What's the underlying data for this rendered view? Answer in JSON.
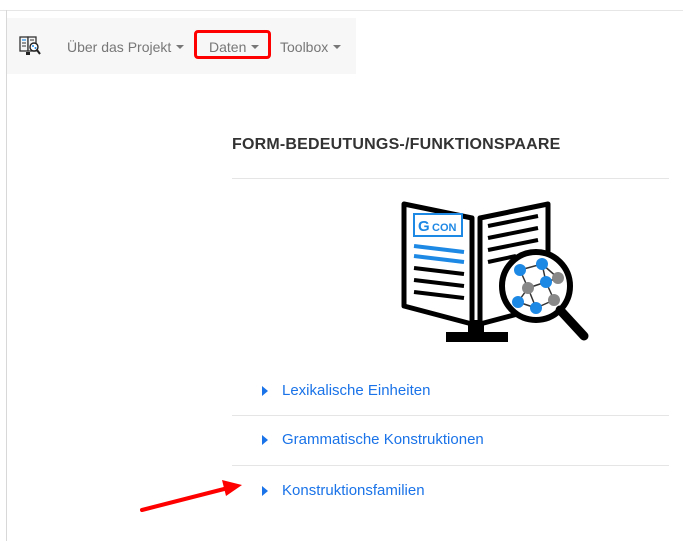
{
  "navbar": {
    "logo_icon": "book-magnifier-icon",
    "items": [
      {
        "label": "Über das Projekt",
        "has_dropdown": true
      },
      {
        "label": "Daten",
        "has_dropdown": true,
        "highlighted": true
      },
      {
        "label": "Toolbox",
        "has_dropdown": true
      }
    ]
  },
  "main": {
    "section_title": "FORM-BEDEUTUNGS-/FUNKTIONSPAARE",
    "illustration": {
      "icon": "gcon-book-network-icon",
      "logo_text_left": "G",
      "logo_text_right": "CON"
    },
    "links": [
      {
        "label": "Lexikalische Einheiten"
      },
      {
        "label": "Grammatische Konstruktionen"
      },
      {
        "label": "Konstruktionsfamilien"
      }
    ]
  },
  "annotations": {
    "highlight_color": "#ff0000",
    "pointer_arrow_icon": "red-arrow-icon"
  },
  "colors": {
    "link": "#1a73e8",
    "nav_text": "#777777",
    "title": "#333333",
    "navbar_bg": "#f7f7f7",
    "accent_blue": "#1e88e5"
  }
}
